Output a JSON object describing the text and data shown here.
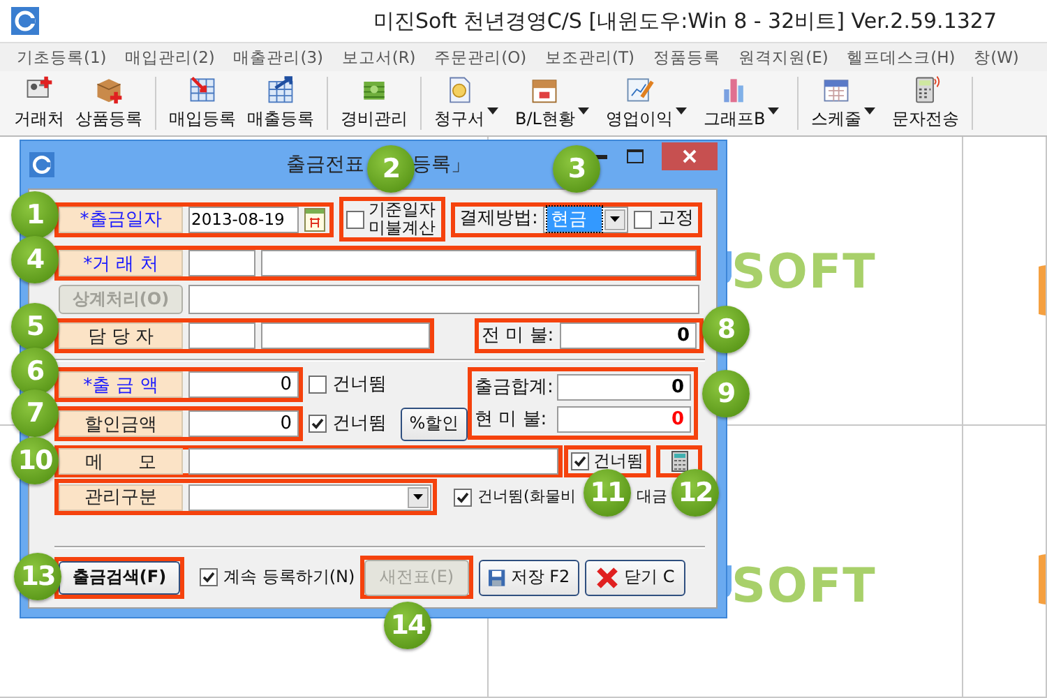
{
  "window": {
    "title": "미진Soft 천년경영C/S [내윈도우:Win 8 - 32비트] Ver.2.59.1327"
  },
  "menu": [
    "기초등록(1)",
    "매입관리(2)",
    "매출관리(3)",
    "보고서(R)",
    "주문관리(O)",
    "보조관리(T)",
    "정품등록",
    "원격지원(E)",
    "헬프데스크(H)",
    "창(W)"
  ],
  "toolbar": [
    {
      "kind": "button",
      "label": "거래처",
      "has_menu": false
    },
    {
      "kind": "button",
      "label": "상품등록",
      "has_menu": false
    },
    {
      "kind": "separator"
    },
    {
      "kind": "button",
      "label": "매입등록",
      "has_menu": false
    },
    {
      "kind": "button",
      "label": "매출등록",
      "has_menu": false
    },
    {
      "kind": "separator"
    },
    {
      "kind": "button",
      "label": "경비관리",
      "has_menu": false
    },
    {
      "kind": "separator"
    },
    {
      "kind": "button",
      "label": "청구서",
      "has_menu": true
    },
    {
      "kind": "button",
      "label": "B/L현황",
      "has_menu": true
    },
    {
      "kind": "button",
      "label": "영업이익",
      "has_menu": true
    },
    {
      "kind": "button",
      "label": "그래프B",
      "has_menu": true
    },
    {
      "kind": "separator"
    },
    {
      "kind": "button",
      "label": "스케줄",
      "has_menu": true
    },
    {
      "kind": "button",
      "label": "문자전송",
      "has_menu": false
    },
    {
      "kind": "separator"
    }
  ],
  "background": {
    "logos": [
      "SOFT",
      "SOFT"
    ]
  },
  "dialog": {
    "title_parts": [
      "출금전표",
      "등록」"
    ],
    "date": {
      "label": "*출금일자",
      "required": true,
      "value": "2013-08-19"
    },
    "base_date": {
      "label_lines": [
        "기준일자",
        "미불계산"
      ],
      "checked": false
    },
    "payment": {
      "label": "결제방법:",
      "value": "현금",
      "fixed": {
        "label": "고정",
        "checked": false
      }
    },
    "client": {
      "label": "*거 래 처",
      "required": true
    },
    "offset_button": {
      "label": "상계처리(O)",
      "disabled": true
    },
    "manager": {
      "label": "담 당 자",
      "required": false
    },
    "prev_unpaid": {
      "label": "전 미 불:",
      "value": "0"
    },
    "amount": {
      "label": "*출 금 액",
      "required": true,
      "value": "0",
      "skip": {
        "label": "건너뜀",
        "checked": false
      }
    },
    "discount": {
      "label": "할인금액",
      "required": false,
      "value": "0",
      "skip": {
        "label": "건너뜀",
        "checked": true
      },
      "button": "%할인"
    },
    "totals": [
      {
        "label": "출금합계:",
        "value": "0",
        "color": "#000000"
      },
      {
        "label": "현 미 불:",
        "value": "0",
        "color": "#ff0000"
      }
    ],
    "memo": {
      "label": "메      모",
      "required": false,
      "skip": {
        "label": "건너뜀",
        "checked": true
      }
    },
    "category": {
      "label": "관리구분",
      "required": false,
      "skip": {
        "label_parts": [
          "건너뜀(화물비",
          "대금"
        ],
        "checked": true
      }
    },
    "footer": {
      "search": "출금검색(F)",
      "continue": {
        "label": "계속 등록하기(N)",
        "checked": true
      },
      "buttons": [
        {
          "label": "새전표(E)",
          "disabled": true,
          "kind": "plain"
        },
        {
          "label": "저장 F2",
          "disabled": false,
          "kind": "save"
        },
        {
          "label": "닫기 C",
          "disabled": false,
          "kind": "close"
        }
      ]
    }
  },
  "callouts": [
    "1",
    "2",
    "3",
    "4",
    "5",
    "6",
    "7",
    "8",
    "9",
    "10",
    "11",
    "12",
    "13",
    "14"
  ]
}
